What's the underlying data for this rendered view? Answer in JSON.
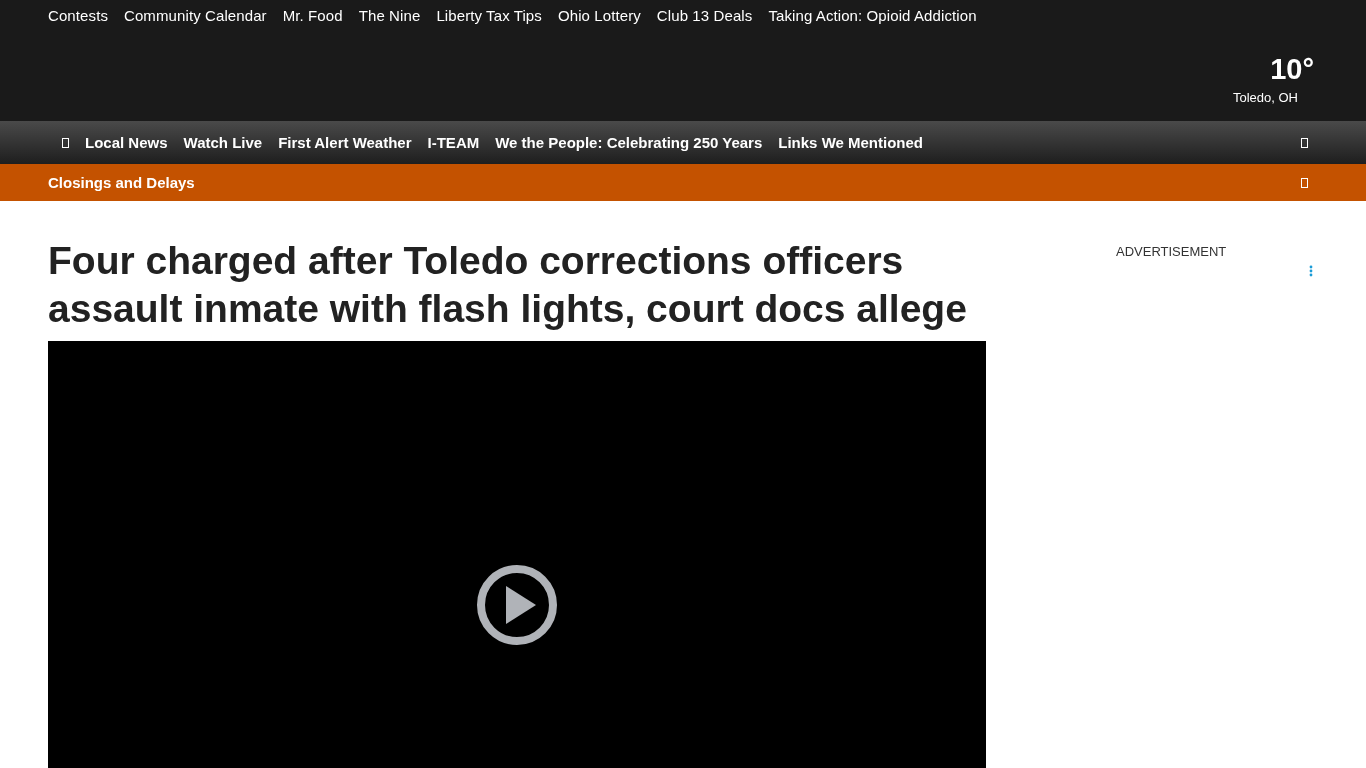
{
  "top_links": [
    "Contests",
    "Community Calendar",
    "Mr. Food",
    "The Nine",
    "Liberty Tax Tips",
    "Ohio Lottery",
    "Club 13 Deals",
    "Taking Action: Opioid Addiction"
  ],
  "weather": {
    "temperature": "10°",
    "location": "Toledo, OH"
  },
  "main_nav": [
    "Local News",
    "Watch Live",
    "First Alert Weather",
    "I-TEAM",
    "We the People: Celebrating 250 Years",
    "Links We Mentioned"
  ],
  "alert_bar": {
    "label": "Closings and Delays"
  },
  "article": {
    "headline": "Four charged after Toledo corrections officers assault inmate with flash lights, court docs allege"
  },
  "sidebar": {
    "ad_label": "ADVERTISEMENT"
  }
}
